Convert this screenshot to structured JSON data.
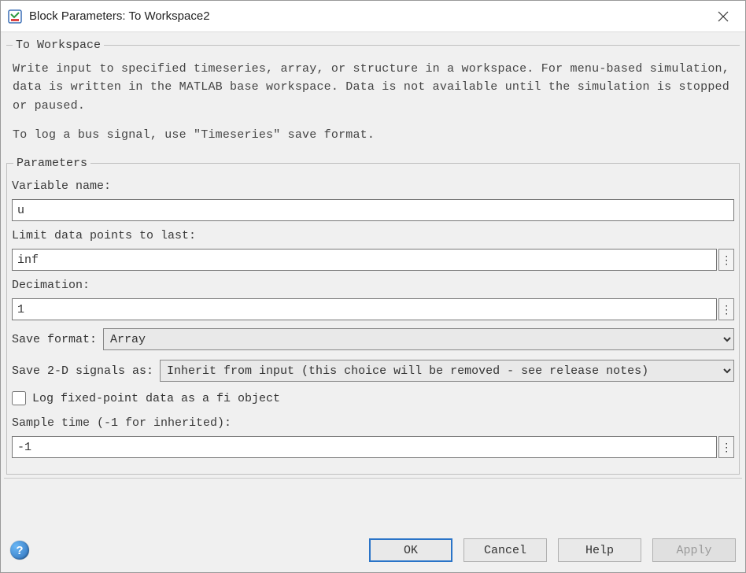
{
  "window": {
    "title": "Block Parameters: To Workspace2"
  },
  "description": {
    "legend": "To Workspace",
    "text1": "Write input to specified timeseries, array, or structure in a workspace. For menu-based simulation, data is written in the MATLAB base workspace. Data is not available until the simulation is stopped or paused.",
    "text2": "To log a bus signal, use \"Timeseries\" save format."
  },
  "params": {
    "legend": "Parameters",
    "variable_name": {
      "label": "Variable name:",
      "value": "u"
    },
    "limit": {
      "label": "Limit data points to last:",
      "value": "inf"
    },
    "decimation": {
      "label": "Decimation:",
      "value": "1"
    },
    "save_format": {
      "label": "Save format:",
      "value": "Array"
    },
    "save_2d": {
      "label": "Save 2-D signals as:",
      "value": "Inherit from input (this choice will be removed - see release notes)"
    },
    "log_fi": {
      "label": "Log fixed-point data as a fi object",
      "checked": false
    },
    "sample_time": {
      "label": "Sample time (-1 for inherited):",
      "value": "-1"
    }
  },
  "buttons": {
    "ok": "OK",
    "cancel": "Cancel",
    "help": "Help",
    "apply": "Apply"
  }
}
